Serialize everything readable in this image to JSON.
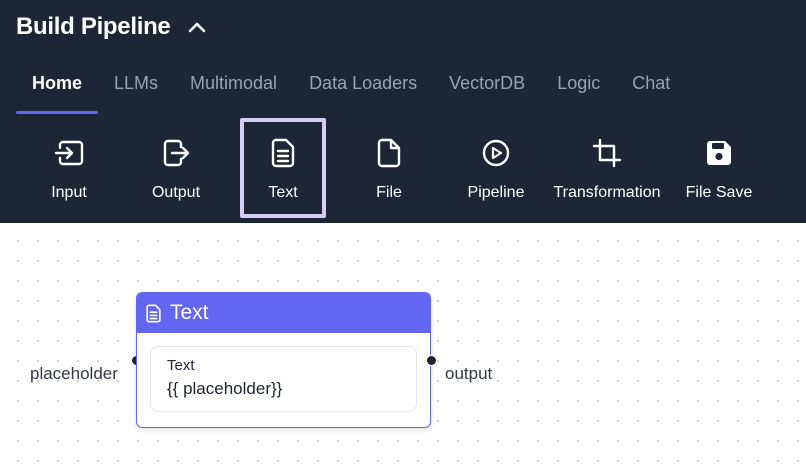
{
  "header": {
    "title": "Build Pipeline",
    "collapse_icon": "chevron-up-icon"
  },
  "tabs": [
    {
      "label": "Home",
      "active": true
    },
    {
      "label": "LLMs",
      "active": false
    },
    {
      "label": "Multimodal",
      "active": false
    },
    {
      "label": "Data Loaders",
      "active": false
    },
    {
      "label": "VectorDB",
      "active": false
    },
    {
      "label": "Logic",
      "active": false
    },
    {
      "label": "Chat",
      "active": false
    }
  ],
  "toolbar": {
    "items": [
      {
        "label": "Input",
        "icon": "input-icon"
      },
      {
        "label": "Output",
        "icon": "output-icon"
      },
      {
        "label": "Text",
        "icon": "document-text-icon",
        "selected": true
      },
      {
        "label": "File",
        "icon": "file-icon"
      },
      {
        "label": "Pipeline",
        "icon": "play-circle-icon"
      },
      {
        "label": "Transformation",
        "icon": "crop-icon"
      },
      {
        "label": "File Save",
        "icon": "floppy-disk-icon"
      }
    ]
  },
  "node": {
    "title": "Text",
    "icon": "document-text-icon",
    "field_label": "Text",
    "field_value": "{{ placeholder}}",
    "input_port": "placeholder",
    "output_port": "output"
  },
  "colors": {
    "header_bg": "#1e2536",
    "accent": "#6366f1",
    "selected_border": "#d8cff8",
    "inactive_tab": "#9aa2b3"
  }
}
